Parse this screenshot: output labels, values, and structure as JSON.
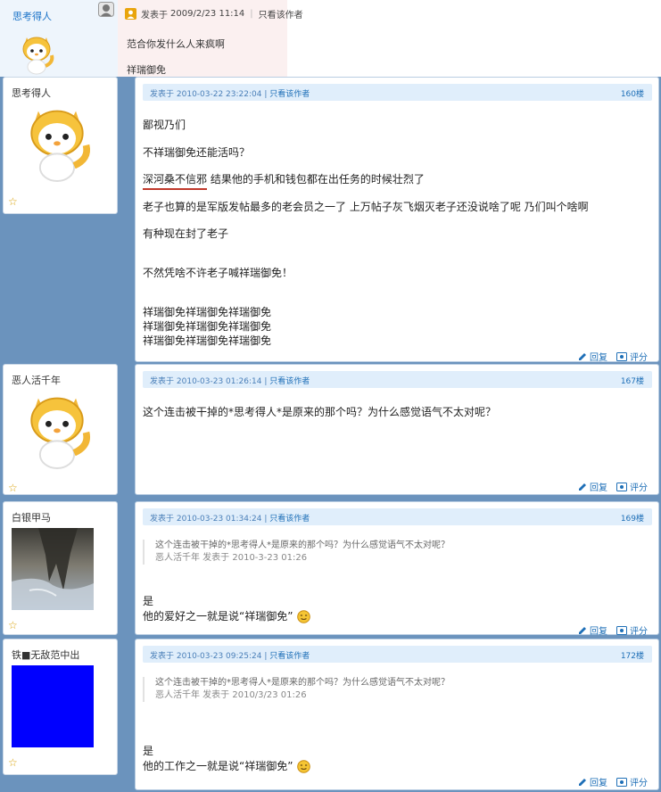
{
  "top_post": {
    "author": "思考得人",
    "meta_prefix": "发表于",
    "date": "2009/2/23 11:14",
    "only_author": "只看该作者",
    "lines": [
      "范合你发什么人来疯啊",
      "祥瑞御免"
    ]
  },
  "posts": [
    {
      "author": "思考得人",
      "avatar": "dragon-mascot",
      "header_prefix": "发表于",
      "date": "2010-03-22 23:22:04",
      "only_author": "只看该作者",
      "floor": "160楼",
      "lines": [
        "鄙视乃们",
        "不祥瑞御免还能活吗？",
        "深河桑不信邪",
        "结果他的手机和钱包都在出任务的时候壮烈了",
        "老子也算的是军版发帖最多的老会员之一了 上万帖子灰飞烟灭老子还没说啥了呢 乃们叫个啥啊",
        "有种现在封了老子",
        "不然凭啥不许老子喊祥瑞御免！",
        "祥瑞御免祥瑞御免祥瑞御免",
        "祥瑞御免祥瑞御免祥瑞御免",
        "祥瑞御免祥瑞御免祥瑞御免"
      ],
      "reply": "回复",
      "rate": "评分"
    },
    {
      "author": "恶人活千年",
      "avatar": "dragon-mascot",
      "header_prefix": "发表于",
      "date": "2010-03-23 01:26:14",
      "only_author": "只看该作者",
      "floor": "167楼",
      "lines": [
        "这个连击被干掉的*思考得人*是原来的那个吗？为什么感觉语气不太对呢？"
      ],
      "reply": "回复",
      "rate": "评分"
    },
    {
      "author": "白银甲马",
      "avatar": "reflection-photo",
      "header_prefix": "发表于",
      "date": "2010-03-23 01:34:24",
      "only_author": "只看该作者",
      "floor": "169楼",
      "quote": {
        "text": "这个连击被干掉的*思考得人*是原来的那个吗？为什么感觉语气不太对呢？",
        "meta": "恶人活千年 发表于 2010-3-23 01:26"
      },
      "lines": [
        "是",
        "他的爱好之一就是说“祥瑞御免”"
      ],
      "reply": "回复",
      "rate": "评分"
    },
    {
      "author": "铁■无敌范中出",
      "avatar": "blue-square",
      "header_prefix": "发表于",
      "date": "2010-03-23 09:25:24",
      "only_author": "只看该作者",
      "floor": "172楼",
      "quote": {
        "text": "这个连击被干掉的*思考得人*是原来的那个吗？为什么感觉语气不太对呢？",
        "meta": "恶人活千年 发表于 2010/3/23 01:26"
      },
      "lines": [
        "是",
        "他的工作之一就是说“祥瑞御免”"
      ],
      "reply": "回复",
      "rate": "评分"
    }
  ],
  "colors": {
    "page_background": "#6b93bd",
    "link": "#1e6fb7",
    "header_bar": "#e0eefb",
    "blue_avatar": "#0000ff"
  }
}
